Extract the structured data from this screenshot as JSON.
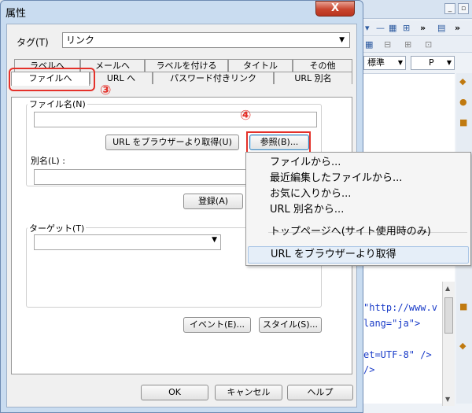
{
  "background_app": {
    "toolbar_select_standard": "標準",
    "toolbar_select_p": "P",
    "code_lines": [
      "\"http://www.v",
      "lang=\"ja\">",
      "et=UTF-8\" />",
      "/>"
    ]
  },
  "dialog": {
    "title": "属性",
    "close_glyph": "X",
    "tag_label": "タグ(T)",
    "tag_value": "リンク",
    "tabs_row1": [
      "ラベルへ",
      "メールへ",
      "ラベルを付ける",
      "タイトル",
      "その他"
    ],
    "tabs_row2": [
      "ファイルへ",
      "URL へ",
      "パスワード付きリンク",
      "URL 別名"
    ],
    "active_tab": "ファイルへ",
    "annotation_3": "③",
    "annotation_4": "④",
    "filename_label": "ファイル名(N)",
    "filename_value": "",
    "get_url_button": "URL をブラウザーより取得(U)",
    "browse_button": "参照(B)...",
    "alias_label": "別名(L) :",
    "alias_value": "",
    "register_button": "登録(A)",
    "target_label": "ターゲット(T)",
    "target_value": "",
    "event_button": "イベント(E)...",
    "style_button": "スタイル(S)...",
    "ok_button": "OK",
    "cancel_button": "キャンセル",
    "help_button": "ヘルプ"
  },
  "popup_menu": {
    "items": [
      "ファイルから...",
      "最近編集したファイルから...",
      "お気に入りから...",
      "URL 別名から...",
      "トップページへ(サイト使用時のみ)",
      "URL をブラウザーより取得"
    ],
    "highlighted_index": 5
  }
}
